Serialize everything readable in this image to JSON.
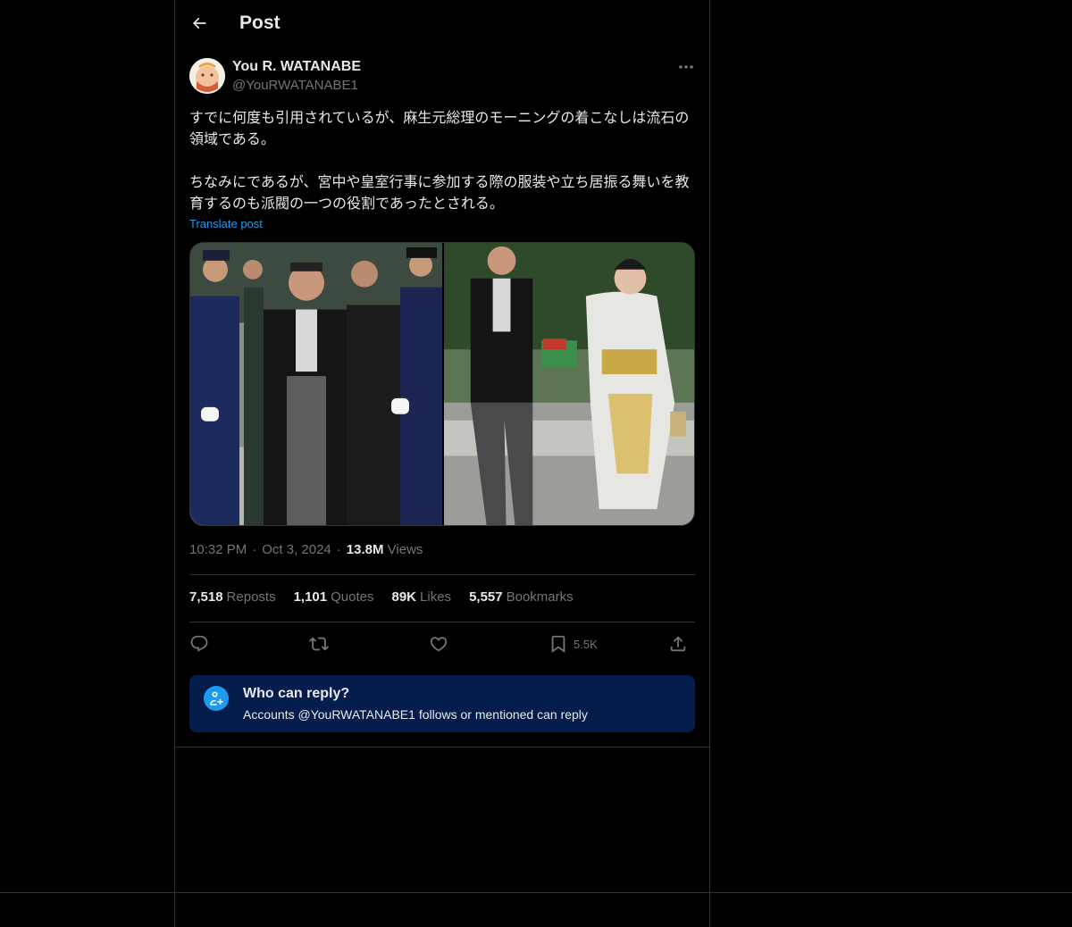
{
  "header": {
    "title": "Post"
  },
  "author": {
    "name": "You R. WATANABE",
    "handle": "@YouRWATANABE1"
  },
  "post": {
    "paragraphs": [
      "すでに何度も引用されているが、麻生元総理のモーニングの着こなしは流石の領域である。",
      "ちなみにであるが、宮中や皇室行事に参加する際の服装や立ち居振る舞いを教育するのも派閥の一つの役割であったとされる。"
    ],
    "translate_label": "Translate post",
    "time": "10:32 PM",
    "date": "Oct 3, 2024",
    "views_count": "13.8M",
    "views_label": "Views"
  },
  "media": [
    {
      "icon": "photo-ceremony-procession"
    },
    {
      "icon": "photo-couple-kimono"
    }
  ],
  "stats": {
    "reposts": {
      "count": "7,518",
      "label": "Reposts"
    },
    "quotes": {
      "count": "1,101",
      "label": "Quotes"
    },
    "likes": {
      "count": "89K",
      "label": "Likes"
    },
    "bookmarks": {
      "count": "5,557",
      "label": "Bookmarks"
    }
  },
  "actions": {
    "reply": {
      "icon": "reply-icon"
    },
    "repost": {
      "icon": "repost-icon"
    },
    "like": {
      "icon": "heart-icon"
    },
    "bookmark": {
      "icon": "bookmark-icon",
      "count": "5.5K"
    },
    "share": {
      "icon": "share-icon"
    }
  },
  "reply_restriction": {
    "title": "Who can reply?",
    "subtitle": "Accounts @YouRWATANABE1 follows or mentioned can reply"
  },
  "colors": {
    "background": "#000000",
    "text": "#e7e9ea",
    "muted": "#71767b",
    "accent": "#1d9bf0",
    "border": "#2f3336",
    "reply_box": "#051d4d"
  }
}
